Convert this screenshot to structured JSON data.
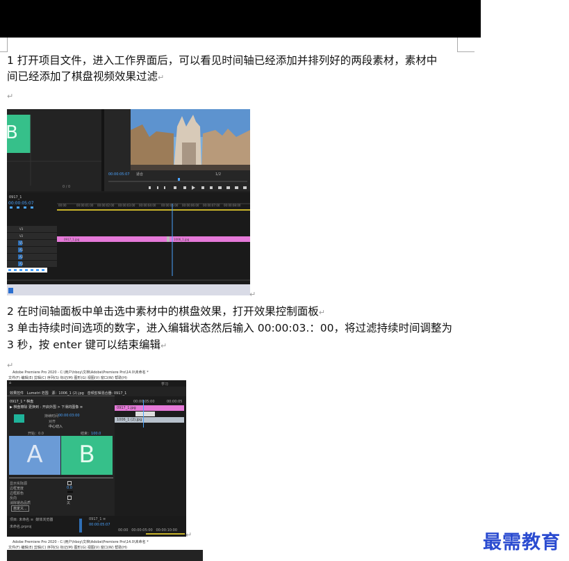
{
  "document": {
    "paragraphs": [
      "1 打开项目文件，进入工作界面后，可以看见时间轴已经添加并排列好的两段素材，素材中",
      "间已经添加了棋盘视频效果过滤",
      "2 在时间轴面板中单击选中素材中的棋盘效果，打开效果控制面板",
      "3 单击持续时间选项的数字，进入编辑状态然后输入 00:00:03.：00，将过滤持续时间调整为",
      "3 秒，按 enter 键可以结束编辑"
    ],
    "return_mark": "↵"
  },
  "screenshot1": {
    "timecode_monitor": "00:00:05:07",
    "timecode_timeline": "00:00:05:07",
    "sequence_name": "0917_1",
    "clip1": "0917_1.jpg",
    "clip2": "1006_1.jpg",
    "tracks": [
      "V3",
      "V2",
      "V1",
      "A1",
      "A2",
      "A3"
    ],
    "master": "主声道",
    "fit": "适合",
    "ratio": "1/2",
    "page_count": "0 / 0"
  },
  "screenshot2": {
    "window_title": "Adobe Premiere Pro 2020 - C:\\用户\\hboy\\文档\\Adobe\\Premiere Pro\\14.0\\未命名 *",
    "menu": [
      "文件(F)",
      "编辑(E)",
      "剪辑(C)",
      "序列(S)",
      "标记(M)",
      "图形(G)",
      "视图(V)",
      "窗口(W)",
      "帮助(H)"
    ],
    "workspace_tab": "学习",
    "panel_tabs": [
      "效果控件",
      "Lumetri 范围",
      "源：1006_1 (2).jpg",
      "音频剪辑混合器: 0917_1"
    ],
    "clip_label": "0917_1 * 棋盘",
    "effect_label": "▶ 棋盘擦除 更换到 : 开启外围 > 下滑的图像 ≡",
    "duration_label": "持续时间",
    "duration_value": "00:00:03:00",
    "align_label": "对齐",
    "align_value": "中心切入",
    "start_label": "开始：",
    "start_value": "0.0",
    "end_label": "结束：",
    "end_value": "100.0",
    "letter_a": "A",
    "letter_b": "B",
    "options": [
      "显示实际源",
      "边框宽度",
      "边框颜色",
      "反向",
      "消除锯齿品质"
    ],
    "border_width": "0.0",
    "aa_value": "关",
    "custom_button": "自定义...",
    "timeline_times": [
      "00:00:05:00",
      "00:00:05"
    ],
    "clip_top": "0917_1.jpg",
    "clip_bottom": "1006_1 (2).jpg",
    "project_tabs": [
      "项目: 未命名 ≡",
      "媒体浏览器"
    ],
    "project_file": "未命名.prproj",
    "seq_tab": "0917_1 ≡",
    "seq_timecode": "00:00:05:07",
    "bottom_times": [
      "00:00",
      "00:00:05:00",
      "00:00:10:00"
    ]
  },
  "screenshot3": {
    "window_title": "Adobe Premiere Pro 2020 - C:\\用户\\hboy\\文档\\Adobe\\Premiere Pro\\14.0\\未命名 *",
    "menu": [
      "文件(F)",
      "编辑(E)",
      "剪辑(C)",
      "序列(S)",
      "标记(M)",
      "图形(G)",
      "视图(V)",
      "窗口(W)",
      "帮助(H)"
    ]
  },
  "watermark": "最需教育",
  "colors": {
    "accent_green": "#36c08a",
    "accent_blue": "#6b9bd6",
    "clip_pink": "#e579d8",
    "watermark": "#2a4bd0"
  }
}
